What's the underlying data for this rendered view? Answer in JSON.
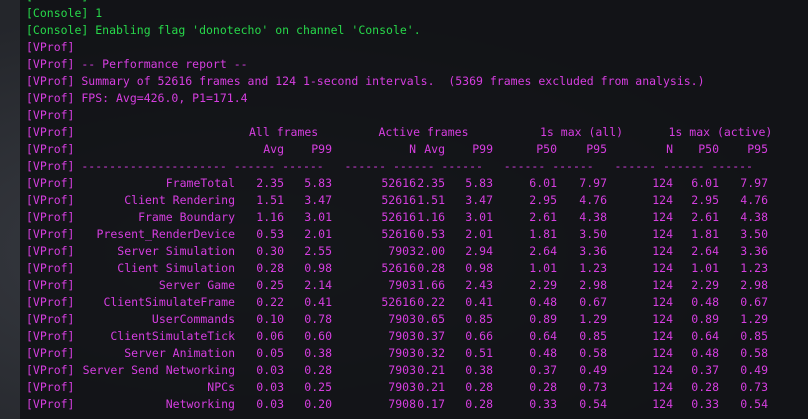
{
  "colors": {
    "console_green": "#27d84a",
    "vprof_magenta": "#d63ee0",
    "background": "#101114"
  },
  "console_lines": [
    {
      "prefix": "[Console]",
      "text": " 1"
    },
    {
      "prefix": "[Console]",
      "text": " 1"
    },
    {
      "prefix": "[Console]",
      "text": " Enabling flag 'donotecho' on channel 'Console'."
    }
  ],
  "vprof_tag": "[VProf]",
  "report": {
    "title": "-- Performance report --",
    "summary": "Summary of 52616 frames and 124 1-second intervals.  (5369 frames excluded from analysis.)",
    "fps": "FPS: Avg=426.0, P1=171.4"
  },
  "group_headers": [
    "All frames",
    "Active frames",
    "1s max (all)",
    "1s max (active)"
  ],
  "columns": [
    "Avg",
    "P99",
    "N",
    "Avg",
    "P99",
    "P50",
    "P95",
    "N",
    "P50",
    "P95"
  ],
  "separator": "--------------------- ------ ------   ------ ------ ------   ------ ------   ------ ------ ------",
  "rows": [
    {
      "name": "FrameTotal",
      "values": [
        "2.35",
        "5.83",
        "52616",
        "2.35",
        "5.83",
        "6.01",
        "7.97",
        "124",
        "6.01",
        "7.97"
      ]
    },
    {
      "name": "Client Rendering",
      "values": [
        "1.51",
        "3.47",
        "52616",
        "1.51",
        "3.47",
        "2.95",
        "4.76",
        "124",
        "2.95",
        "4.76"
      ]
    },
    {
      "name": "Frame Boundary",
      "values": [
        "1.16",
        "3.01",
        "52616",
        "1.16",
        "3.01",
        "2.61",
        "4.38",
        "124",
        "2.61",
        "4.38"
      ]
    },
    {
      "name": "Present_RenderDevice",
      "values": [
        "0.53",
        "2.01",
        "52616",
        "0.53",
        "2.01",
        "1.81",
        "3.50",
        "124",
        "1.81",
        "3.50"
      ]
    },
    {
      "name": "Server Simulation",
      "values": [
        "0.30",
        "2.55",
        "7903",
        "2.00",
        "2.94",
        "2.64",
        "3.36",
        "124",
        "2.64",
        "3.36"
      ]
    },
    {
      "name": "Client Simulation",
      "values": [
        "0.28",
        "0.98",
        "52616",
        "0.28",
        "0.98",
        "1.01",
        "1.23",
        "124",
        "1.01",
        "1.23"
      ]
    },
    {
      "name": "Server Game",
      "values": [
        "0.25",
        "2.14",
        "7903",
        "1.66",
        "2.43",
        "2.29",
        "2.98",
        "124",
        "2.29",
        "2.98"
      ]
    },
    {
      "name": "ClientSimulateFrame",
      "values": [
        "0.22",
        "0.41",
        "52616",
        "0.22",
        "0.41",
        "0.48",
        "0.67",
        "124",
        "0.48",
        "0.67"
      ]
    },
    {
      "name": "UserCommands",
      "values": [
        "0.10",
        "0.78",
        "7903",
        "0.65",
        "0.85",
        "0.89",
        "1.29",
        "124",
        "0.89",
        "1.29"
      ]
    },
    {
      "name": "ClientSimulateTick",
      "values": [
        "0.06",
        "0.60",
        "7903",
        "0.37",
        "0.66",
        "0.64",
        "0.85",
        "124",
        "0.64",
        "0.85"
      ]
    },
    {
      "name": "Server Animation",
      "values": [
        "0.05",
        "0.38",
        "7903",
        "0.32",
        "0.51",
        "0.48",
        "0.58",
        "124",
        "0.48",
        "0.58"
      ]
    },
    {
      "name": "Server Send Networking",
      "values": [
        "0.03",
        "0.28",
        "7903",
        "0.21",
        "0.38",
        "0.37",
        "0.49",
        "124",
        "0.37",
        "0.49"
      ]
    },
    {
      "name": "NPCs",
      "values": [
        "0.03",
        "0.25",
        "7903",
        "0.21",
        "0.28",
        "0.28",
        "0.73",
        "124",
        "0.28",
        "0.73"
      ]
    },
    {
      "name": "Networking",
      "values": [
        "0.03",
        "0.20",
        "7908",
        "0.17",
        "0.28",
        "0.33",
        "0.54",
        "124",
        "0.33",
        "0.54"
      ]
    }
  ]
}
